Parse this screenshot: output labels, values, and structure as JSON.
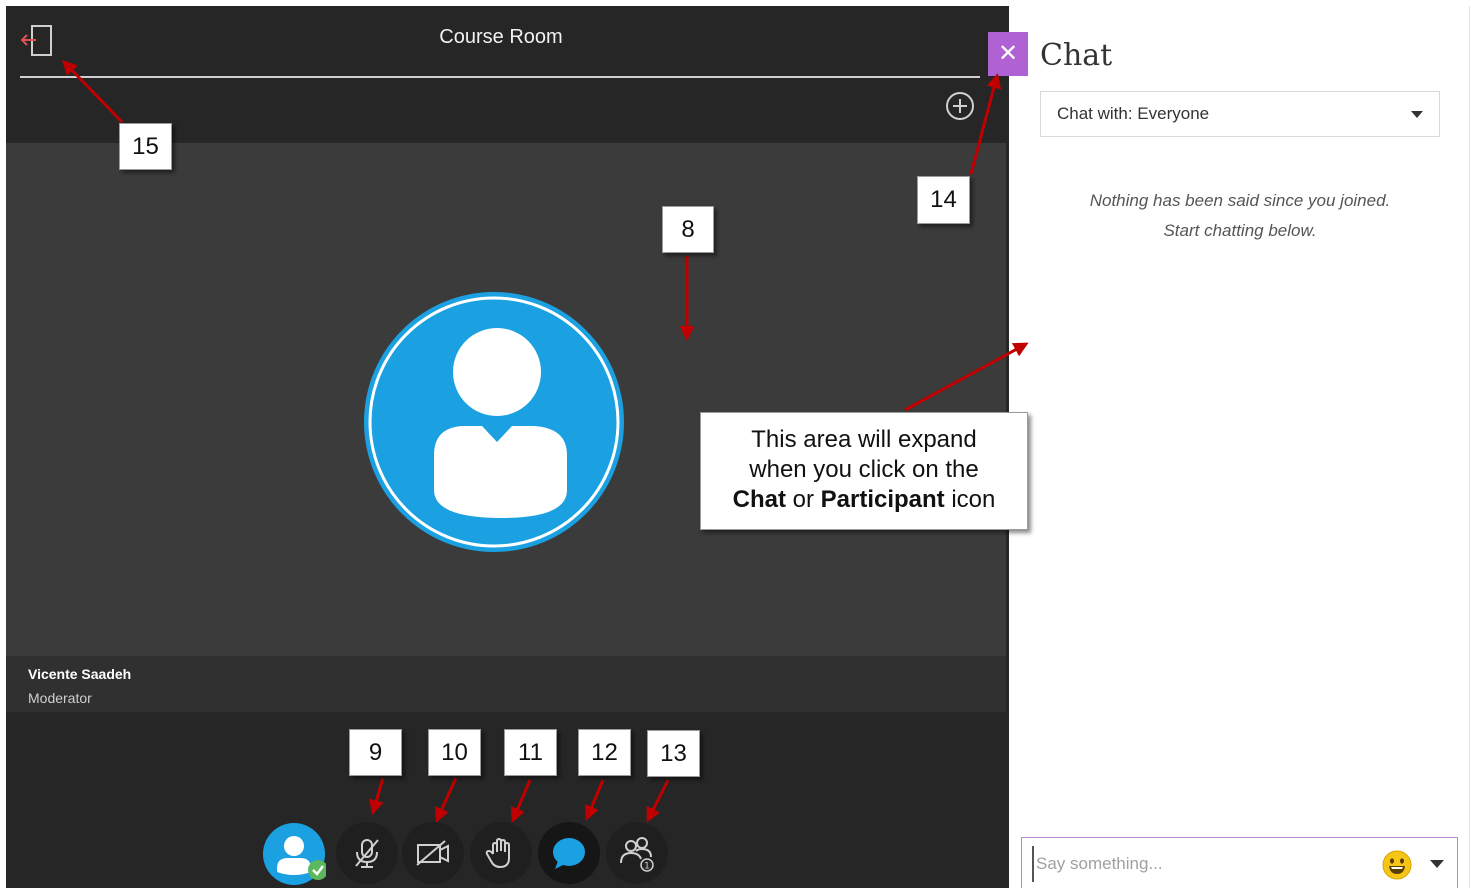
{
  "session": {
    "title": "Course Room",
    "presenter": {
      "name": "Vicente Saadeh",
      "role": "Moderator"
    }
  },
  "icons": {
    "leave": "leave-session-icon",
    "add": "add-plus-icon",
    "avatar": "user-avatar-icon",
    "controls": [
      "my-status-icon",
      "microphone-off-icon",
      "camera-off-icon",
      "raise-hand-icon",
      "chat-icon",
      "attendees-icon"
    ],
    "close": "close-icon",
    "emoji": "emoji-icon"
  },
  "chat": {
    "close_label": "✕",
    "title": "Chat",
    "chat_with": "Chat with: Everyone",
    "empty_line1": "Nothing has been said since you joined.",
    "empty_line2": "Start chatting below.",
    "input_placeholder": "Say something..."
  },
  "annotations": {
    "labels": [
      "8",
      "9",
      "10",
      "11",
      "12",
      "13",
      "14",
      "15"
    ],
    "callout": {
      "line1": "This area will expand",
      "line2": "when you click on the",
      "chat_word": "Chat",
      "or_word": " or ",
      "participant_word": "Participant",
      "icon_word": " icon"
    }
  },
  "colors": {
    "session_bg": "#262626",
    "stage_bg": "#3b3b3b",
    "avatar_blue": "#1ba1e2",
    "close_purple": "#b061d3",
    "arrow_red": "#c00000",
    "status_green": "#5cb85c"
  }
}
